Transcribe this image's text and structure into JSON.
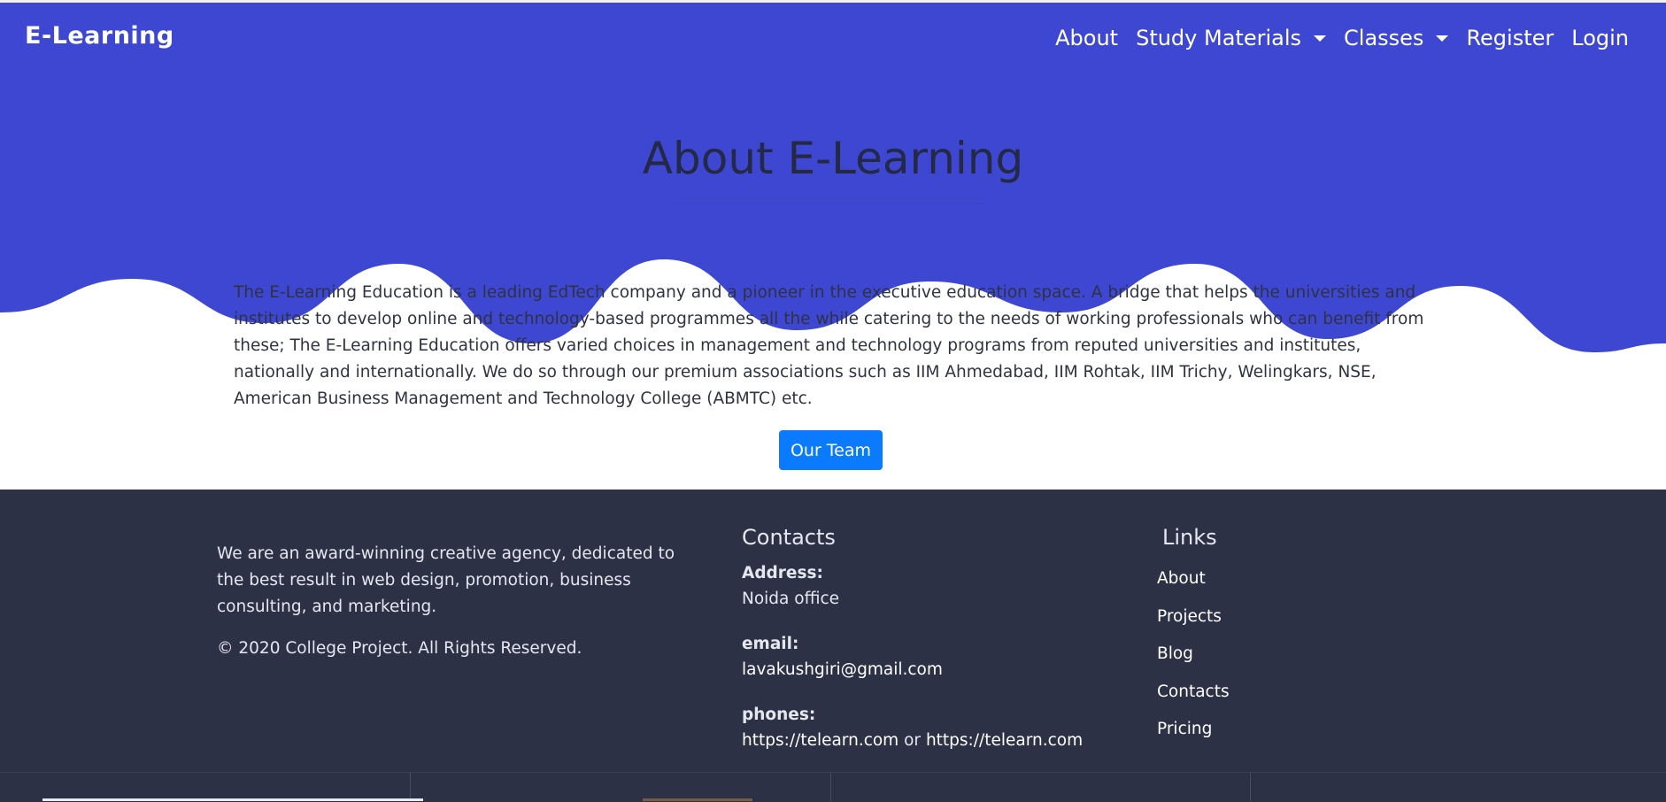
{
  "brand": {
    "name": "E-Learning"
  },
  "nav": {
    "about": "About",
    "study_materials": "Study Materials",
    "classes": "Classes",
    "register": "Register",
    "login": "Login"
  },
  "hero": {
    "title": "About E-Learning",
    "body": "The E-Learning Education is a leading EdTech company and a pioneer in the executive education space. A bridge that helps the universities and institutes to develop online and technology-based programmes all the while catering to the needs of working professionals who can benefit from these; The E-Learning Education offers varied choices in management and technology programs from reputed universities and institutes, nationally and internationally. We do so through our premium associations such as IIM Ahmedabad, IIM Rohtak, IIM Trichy, Welingkars, NSE, American Business Management and Technology College (ABMTC) etc.",
    "team_button": "Our Team"
  },
  "footer": {
    "description": "We are an award-winning creative agency, dedicated to the best result in web design, promotion, business consulting, and marketing.",
    "copyright": "©  2020 College Project. All Rights Reserved.",
    "contacts": {
      "heading": "Contacts",
      "address_label": "Address:",
      "address_value": "Noida office",
      "email_label": "email:",
      "email_value": "lavakushgiri@gmail.com",
      "phones_label": "phones:",
      "phone_1": "https://telearn.com",
      "phone_separator": "or",
      "phone_2": "https://telearn.com"
    },
    "links": {
      "heading": "Links",
      "items": [
        "About",
        "Projects",
        "Blog",
        "Contacts",
        "Pricing"
      ]
    }
  },
  "colors": {
    "hero_blue": "#3d47d1",
    "footer_bg": "#2d3145",
    "button_blue": "#0a7bff",
    "title_text": "#242a45"
  },
  "icons": {
    "dropdown": "caret-down-icon"
  }
}
